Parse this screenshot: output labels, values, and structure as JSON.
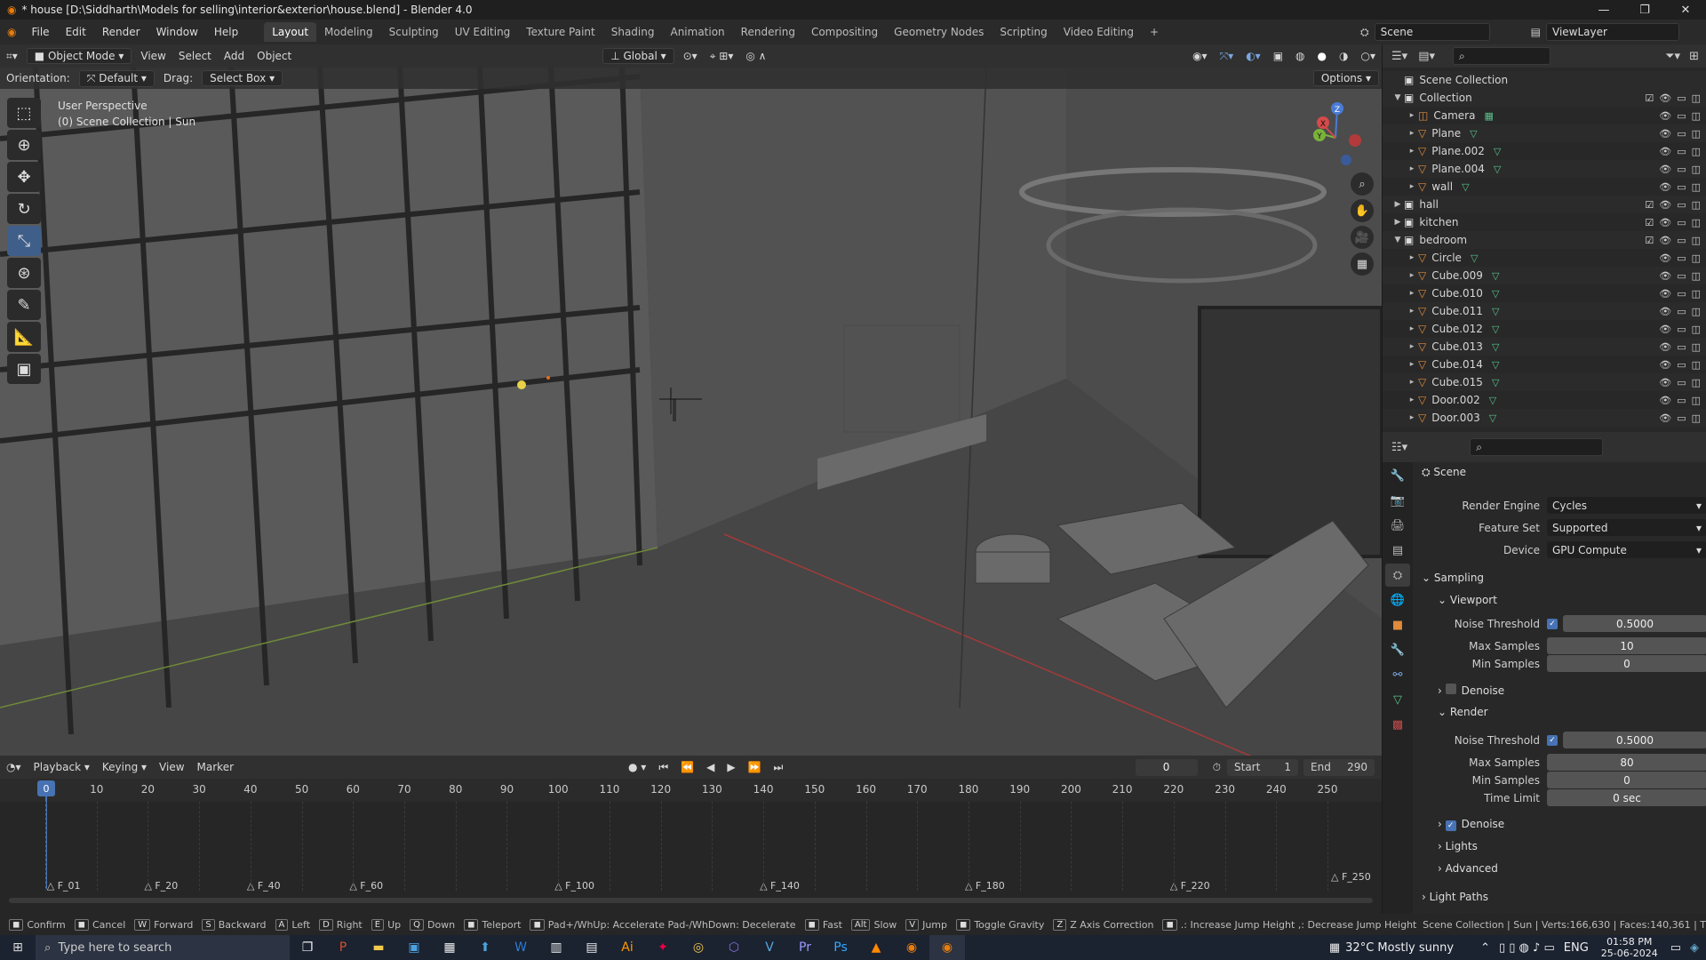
{
  "window": {
    "title": "* house [D:\\Siddharth\\Models for selling\\interior&exterior\\house.blend] - Blender 4.0",
    "controls": [
      "—",
      "❐",
      "✕"
    ]
  },
  "menus": [
    "File",
    "Edit",
    "Render",
    "Window",
    "Help"
  ],
  "workspaces": [
    "Layout",
    "Modeling",
    "Sculpting",
    "UV Editing",
    "Texture Paint",
    "Shading",
    "Animation",
    "Rendering",
    "Compositing",
    "Geometry Nodes",
    "Scripting",
    "Video Editing",
    "+"
  ],
  "active_workspace": "Layout",
  "scene": {
    "label": "Scene",
    "view_layer": "ViewLayer"
  },
  "viewport_header": {
    "mode": "Object Mode",
    "menus": [
      "View",
      "Select",
      "Add",
      "Object"
    ],
    "transform": "Global",
    "orientation_label": "Orientation:",
    "orientation_value": "Default",
    "drag_label": "Drag:",
    "drag_value": "Select Box",
    "options": "Options"
  },
  "viewport_info": {
    "line1": "User Perspective",
    "line2": "(0) Scene Collection | Sun"
  },
  "gizmo": {
    "z": "Z",
    "y": "Y",
    "x": "X"
  },
  "outliner": {
    "root": "Scene Collection",
    "rows": [
      {
        "name": "Collection",
        "depth": 1,
        "expanded": true,
        "type": "collection"
      },
      {
        "name": "Camera",
        "depth": 2,
        "type": "camera"
      },
      {
        "name": "Plane",
        "depth": 2,
        "type": "mesh"
      },
      {
        "name": "Plane.002",
        "depth": 2,
        "type": "mesh"
      },
      {
        "name": "Plane.004",
        "depth": 2,
        "type": "mesh"
      },
      {
        "name": "wall",
        "depth": 2,
        "type": "mesh"
      },
      {
        "name": "hall",
        "depth": 1,
        "expanded": false,
        "type": "collection"
      },
      {
        "name": "kitchen",
        "depth": 1,
        "expanded": false,
        "type": "collection"
      },
      {
        "name": "bedroom",
        "depth": 1,
        "expanded": true,
        "type": "collection"
      },
      {
        "name": "Circle",
        "depth": 2,
        "type": "mesh"
      },
      {
        "name": "Cube.009",
        "depth": 2,
        "type": "mesh"
      },
      {
        "name": "Cube.010",
        "depth": 2,
        "type": "mesh"
      },
      {
        "name": "Cube.011",
        "depth": 2,
        "type": "mesh"
      },
      {
        "name": "Cube.012",
        "depth": 2,
        "type": "mesh"
      },
      {
        "name": "Cube.013",
        "depth": 2,
        "type": "mesh"
      },
      {
        "name": "Cube.014",
        "depth": 2,
        "type": "mesh"
      },
      {
        "name": "Cube.015",
        "depth": 2,
        "type": "mesh"
      },
      {
        "name": "Door.002",
        "depth": 2,
        "type": "mesh"
      },
      {
        "name": "Door.003",
        "depth": 2,
        "type": "mesh"
      }
    ]
  },
  "properties": {
    "context": "Scene",
    "render_engine_label": "Render Engine",
    "render_engine": "Cycles",
    "feature_set_label": "Feature Set",
    "feature_set": "Supported",
    "device_label": "Device",
    "device": "GPU Compute",
    "sampling": "Sampling",
    "viewport": "Viewport",
    "noise_threshold_label": "Noise Threshold",
    "vp_noise_threshold": "0.5000",
    "max_samples_label": "Max Samples",
    "vp_max_samples": "10",
    "min_samples_label": "Min Samples",
    "vp_min_samples": "0",
    "denoise": "Denoise",
    "render": "Render",
    "r_noise_threshold": "0.5000",
    "r_max_samples": "80",
    "r_min_samples": "0",
    "time_limit_label": "Time Limit",
    "r_time_limit": "0 sec",
    "lights": "Lights",
    "advanced": "Advanced",
    "light_paths": "Light Paths"
  },
  "timeline": {
    "menus": [
      "Playback",
      "Keying",
      "View",
      "Marker"
    ],
    "current_frame": "0",
    "start_label": "Start",
    "start": "1",
    "end_label": "End",
    "end": "290",
    "ticks": [
      "0",
      "10",
      "20",
      "30",
      "40",
      "50",
      "60",
      "70",
      "80",
      "90",
      "100",
      "110",
      "120",
      "130",
      "140",
      "150",
      "160",
      "170",
      "180",
      "190",
      "200",
      "210",
      "220",
      "230",
      "240",
      "250"
    ],
    "markers": [
      "F_01",
      "F_20",
      "F_40",
      "F_60",
      "F_100",
      "F_140",
      "F_180",
      "F_220",
      "F_250"
    ]
  },
  "statusbar": {
    "items": [
      {
        "key": "",
        "label": "Confirm"
      },
      {
        "key": "",
        "label": "Cancel"
      },
      {
        "key": "W",
        "label": "Forward"
      },
      {
        "key": "S",
        "label": "Backward"
      },
      {
        "key": "A",
        "label": "Left"
      },
      {
        "key": "D",
        "label": "Right"
      },
      {
        "key": "E",
        "label": "Up"
      },
      {
        "key": "Q",
        "label": "Down"
      },
      {
        "key": "",
        "label": "Teleport"
      },
      {
        "key": "",
        "label": "Pad+/WhUp: Accelerate  Pad-/WhDown: Decelerate"
      },
      {
        "key": "",
        "label": "Fast"
      },
      {
        "key": "Alt",
        "label": "Slow"
      },
      {
        "key": "V",
        "label": "Jump"
      },
      {
        "key": "",
        "label": "Toggle Gravity"
      },
      {
        "key": "Z",
        "label": "Z Axis Correction"
      },
      {
        "key": "",
        "label": ".: Increase Jump Height  ,: Decrease Jump Height"
      }
    ],
    "right": "Scene Collection | Sun | Verts:166,630 | Faces:140,361 | T"
  },
  "taskbar": {
    "search_placeholder": "Type here to search",
    "weather": "32°C  Mostly sunny",
    "lang": "ENG",
    "time": "01:58 PM",
    "date": "25-06-2024"
  }
}
